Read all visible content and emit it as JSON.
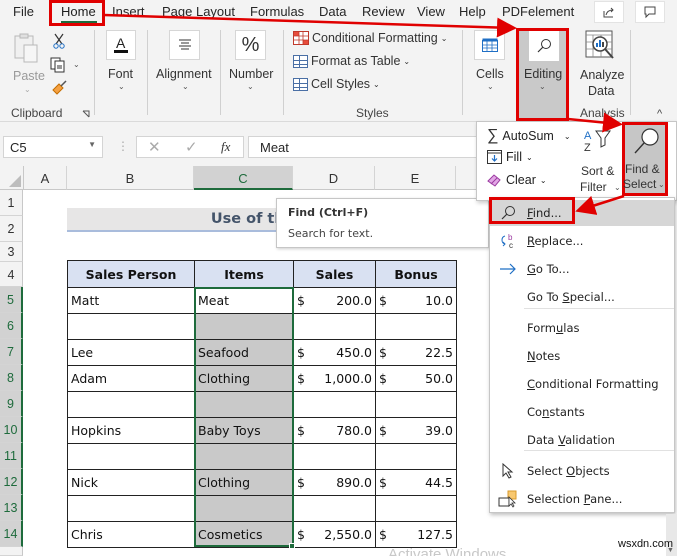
{
  "ribbon_tabs": [
    "File",
    "Home",
    "Insert",
    "Page Layout",
    "Formulas",
    "Data",
    "Review",
    "View",
    "Help",
    "PDFelement"
  ],
  "active_tab": "Home",
  "top_buttons": {
    "share": "share-icon",
    "comments": "comment-icon"
  },
  "ribbon": {
    "clipboard": {
      "paste": "Paste",
      "label": "Clipboard"
    },
    "font": "Font",
    "alignment": "Alignment",
    "number": "Number",
    "styles": {
      "conditional_formatting": "Conditional Formatting",
      "format_as_table": "Format as Table",
      "cell_styles": "Cell Styles",
      "label": "Styles"
    },
    "cells": "Cells",
    "editing": "Editing",
    "analyze_data": [
      "Analyze",
      "Data"
    ],
    "analysis_label": "Analysis"
  },
  "formula_bar": {
    "name_box": "C5",
    "fx": "fx",
    "value": "Meat"
  },
  "columns": [
    "A",
    "B",
    "C",
    "D",
    "E"
  ],
  "selected_column": "C",
  "rows": [
    "1",
    "2",
    "3",
    "4",
    "5",
    "6",
    "7",
    "8",
    "9",
    "10",
    "11",
    "12",
    "13",
    "14"
  ],
  "sheet_title": "Use of the Finac",
  "table": {
    "headers": [
      "Sales Person",
      "Items",
      "Sales",
      "Bonus"
    ],
    "currency": "$",
    "rows": [
      {
        "person": "Matt",
        "item": "Meat",
        "sales": "200.0",
        "bonus": "10.0"
      },
      {
        "person": "",
        "item": "",
        "sales": "",
        "bonus": ""
      },
      {
        "person": "Lee",
        "item": "Seafood",
        "sales": "450.0",
        "bonus": "22.5"
      },
      {
        "person": "Adam",
        "item": "Clothing",
        "sales": "1,000.0",
        "bonus": "50.0"
      },
      {
        "person": "",
        "item": "",
        "sales": "",
        "bonus": ""
      },
      {
        "person": "Hopkins",
        "item": "Baby Toys",
        "sales": "780.0",
        "bonus": "39.0"
      },
      {
        "person": "",
        "item": "",
        "sales": "",
        "bonus": ""
      },
      {
        "person": "Nick",
        "item": "Clothing",
        "sales": "890.0",
        "bonus": "44.5"
      },
      {
        "person": "",
        "item": "",
        "sales": "",
        "bonus": ""
      },
      {
        "person": "Chris",
        "item": "Cosmetics",
        "sales": "2,550.0",
        "bonus": "127.5"
      }
    ]
  },
  "tooltip": {
    "title": "Find (Ctrl+F)",
    "description": "Search for text."
  },
  "editing_dropdown": {
    "autosum": "AutoSum",
    "fill": "Fill",
    "clear": "Clear",
    "sort_filter": [
      "Sort &",
      "Filter"
    ],
    "find_select": [
      "Find &",
      "Select"
    ]
  },
  "find_menu": [
    {
      "pre": "",
      "u": "F",
      "post": "ind...",
      "icon": "search-icon"
    },
    {
      "pre": "",
      "u": "R",
      "post": "eplace...",
      "icon": "replace-icon"
    },
    {
      "pre": "",
      "u": "G",
      "post": "o To...",
      "icon": "arrow-right-icon"
    },
    {
      "pre": "Go To ",
      "u": "S",
      "post": "pecial...",
      "icon": ""
    },
    {
      "pre": "Form",
      "u": "u",
      "post": "las",
      "icon": ""
    },
    {
      "pre": "",
      "u": "N",
      "post": "otes",
      "icon": ""
    },
    {
      "pre": "",
      "u": "C",
      "post": "onditional Formatting",
      "icon": ""
    },
    {
      "pre": "Co",
      "u": "n",
      "post": "stants",
      "icon": ""
    },
    {
      "pre": "Data ",
      "u": "V",
      "post": "alidation",
      "icon": ""
    },
    {
      "pre": "Select ",
      "u": "O",
      "post": "bjects",
      "icon": "pointer-icon"
    },
    {
      "pre": "Selection ",
      "u": "P",
      "post": "ane...",
      "icon": "selection-pane-icon"
    }
  ],
  "watermark": "wsxdn.com",
  "activate_text": "Activate Windows"
}
